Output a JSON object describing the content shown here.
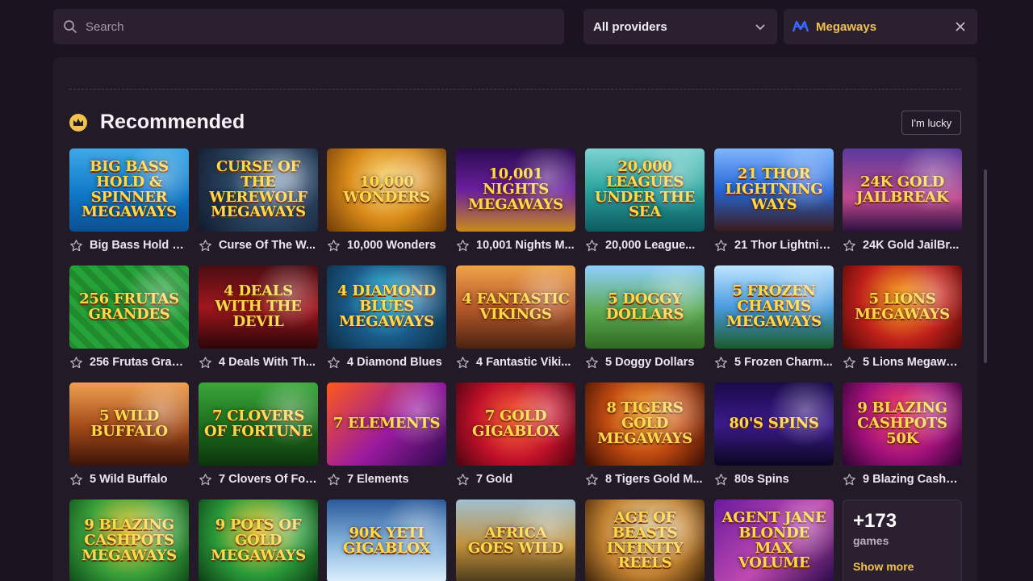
{
  "search": {
    "placeholder": "Search"
  },
  "providers": {
    "label": "All providers"
  },
  "filter": {
    "label": "Megaways"
  },
  "section": {
    "title": "Recommended",
    "lucky_label": "I'm lucky"
  },
  "colors": {
    "accent": "#f1c24c",
    "background": "#1c1320",
    "panel": "#231a28"
  },
  "games": [
    {
      "title": "Big Bass Hold & ...",
      "art": "Big Bass Hold & Spinner Megaways",
      "bg": "linear-gradient(180deg,#3fa9e8 0%,#0f78c7 55%,#0b4f92 100%)"
    },
    {
      "title": "Curse Of The W...",
      "art": "Curse of the Werewolf Megaways",
      "bg": "radial-gradient(circle at 60% 40%,#9ab3c9 0%,#2b4563 45%,#101a2b 100%)"
    },
    {
      "title": "10,000 Wonders",
      "art": "10,000 Wonders",
      "bg": "radial-gradient(circle at 50% 40%,#ffe28a 0%,#d98a18 50%,#6e3a08 100%)"
    },
    {
      "title": "10,001 Nights M...",
      "art": "10,001 Nights Megaways",
      "bg": "linear-gradient(180deg,#2a0b4f 0%,#6b1f9e 50%,#c98a1a 100%)"
    },
    {
      "title": "20,000 League...",
      "art": "20,000 Leagues Under the Sea",
      "bg": "linear-gradient(180deg,#7ed4d2 0%,#2aa39c 50%,#0d5b61 100%)"
    },
    {
      "title": "21 Thor Lightnin...",
      "art": "21 Thor Lightning Ways",
      "bg": "linear-gradient(180deg,#7fb6ff 0%,#2766d6 50%,#3a1a1a 100%)"
    },
    {
      "title": "24K Gold JailBr...",
      "art": "24K Gold Jailbreak",
      "bg": "linear-gradient(180deg,#5a3a9e 0%,#c04a8e 60%,#2b1040 100%)"
    },
    {
      "title": "256 Frutas Gran...",
      "art": "256 Frutas Grandes",
      "bg": "repeating-linear-gradient(45deg,#1f8a2e 0 8px,#26a238 8px 16px)"
    },
    {
      "title": "4 Deals With Th...",
      "art": "4 Deals with the Devil",
      "bg": "linear-gradient(180deg,#4a0d12 0%,#a0171d 50%,#2b0508 100%)"
    },
    {
      "title": "4 Diamond Blues",
      "art": "4 Diamond Blues Megaways",
      "bg": "radial-gradient(circle at 50% 40%,#4ad6f0 0%,#1a5b8a 50%,#0b2a40 100%)"
    },
    {
      "title": "4 Fantastic Viki...",
      "art": "4 Fantastic Vikings",
      "bg": "linear-gradient(180deg,#f0a24a 0%,#b85a2a 50%,#4a2210 100%)"
    },
    {
      "title": "5 Doggy Dollars",
      "art": "5 Doggy Dollars",
      "bg": "linear-gradient(180deg,#8fd0ff 0%,#5aa850 55%,#2f6a22 100%)"
    },
    {
      "title": "5 Frozen Charm...",
      "art": "5 Frozen Charms Megaways",
      "bg": "linear-gradient(180deg,#bfe6ff 0%,#4a9be0 50%,#1a5a2a 100%)"
    },
    {
      "title": "5 Lions Megawa...",
      "art": "5 Lions Megaways",
      "bg": "radial-gradient(circle at 50% 40%,#ffb02a 0%,#c0201a 55%,#4a0808 100%)"
    },
    {
      "title": "5 Wild Buffalo",
      "art": "5 Wild Buffalo",
      "bg": "linear-gradient(180deg,#f0a050 0%,#a04818 55%,#3a1208 100%)"
    },
    {
      "title": "7 Clovers Of For...",
      "art": "7 Clovers of Fortune",
      "bg": "linear-gradient(180deg,#3aa83a 0%,#1c6a1c 55%,#0c340c 100%)"
    },
    {
      "title": "7 Elements",
      "art": "7 Elements",
      "bg": "linear-gradient(135deg,#ff5a1a 0%,#9a1aa0 55%,#2a0a4a 100%)"
    },
    {
      "title": "7 Gold",
      "art": "7 Gold Gigablox",
      "bg": "radial-gradient(circle at 50% 45%,#ff6a3a 0%,#c0102a 55%,#4a0410 100%)"
    },
    {
      "title": "8 Tigers Gold M...",
      "art": "8 Tigers Gold Megaways",
      "bg": "radial-gradient(circle at 50% 40%,#ffb84a 0%,#c04a10 50%,#3a0c04 100%)"
    },
    {
      "title": "80s Spins",
      "art": "80's Spins",
      "bg": "linear-gradient(180deg,#1a0a4a 0%,#3a1a8a 50%,#0a0620 100%)"
    },
    {
      "title": "9 Blazing Cashp...",
      "art": "9 Blazing Cashpots 50K",
      "bg": "radial-gradient(circle at 50% 40%,#ff4a6a 0%,#a0107a 55%,#2a0430 100%)"
    },
    {
      "title": "",
      "art": "9 Blazing Cashpots Megaways",
      "bg": "radial-gradient(circle at 50% 40%,#ffd84a 0%,#3aa03a 55%,#0c4a1a 100%)"
    },
    {
      "title": "",
      "art": "9 Pots of Gold Megaways",
      "bg": "radial-gradient(circle at 50% 40%,#ffd84a 0%,#2a9a3a 55%,#0c3a14 100%)"
    },
    {
      "title": "",
      "art": "90k Yeti Gigablox",
      "bg": "linear-gradient(180deg,#2a5a9a 0%,#8ab8e0 55%,#e0f0ff 100%)"
    },
    {
      "title": "",
      "art": "Africa Goes Wild",
      "bg": "linear-gradient(180deg,#a0c0d0 0%,#c0903a 55%,#4a3a1a 100%)"
    },
    {
      "title": "",
      "art": "Age of Beasts Infinity Reels",
      "bg": "radial-gradient(circle at 50% 40%,#f0e0b0 0%,#c08030 55%,#3a2008 100%)"
    },
    {
      "title": "",
      "art": "Agent Jane Blonde Max Volume",
      "bg": "linear-gradient(135deg,#6a1aa0 0%,#c04ab0 55%,#2a0a4a 100%)"
    }
  ],
  "more": {
    "count": "+173",
    "unit": "games",
    "link": "Show more"
  }
}
